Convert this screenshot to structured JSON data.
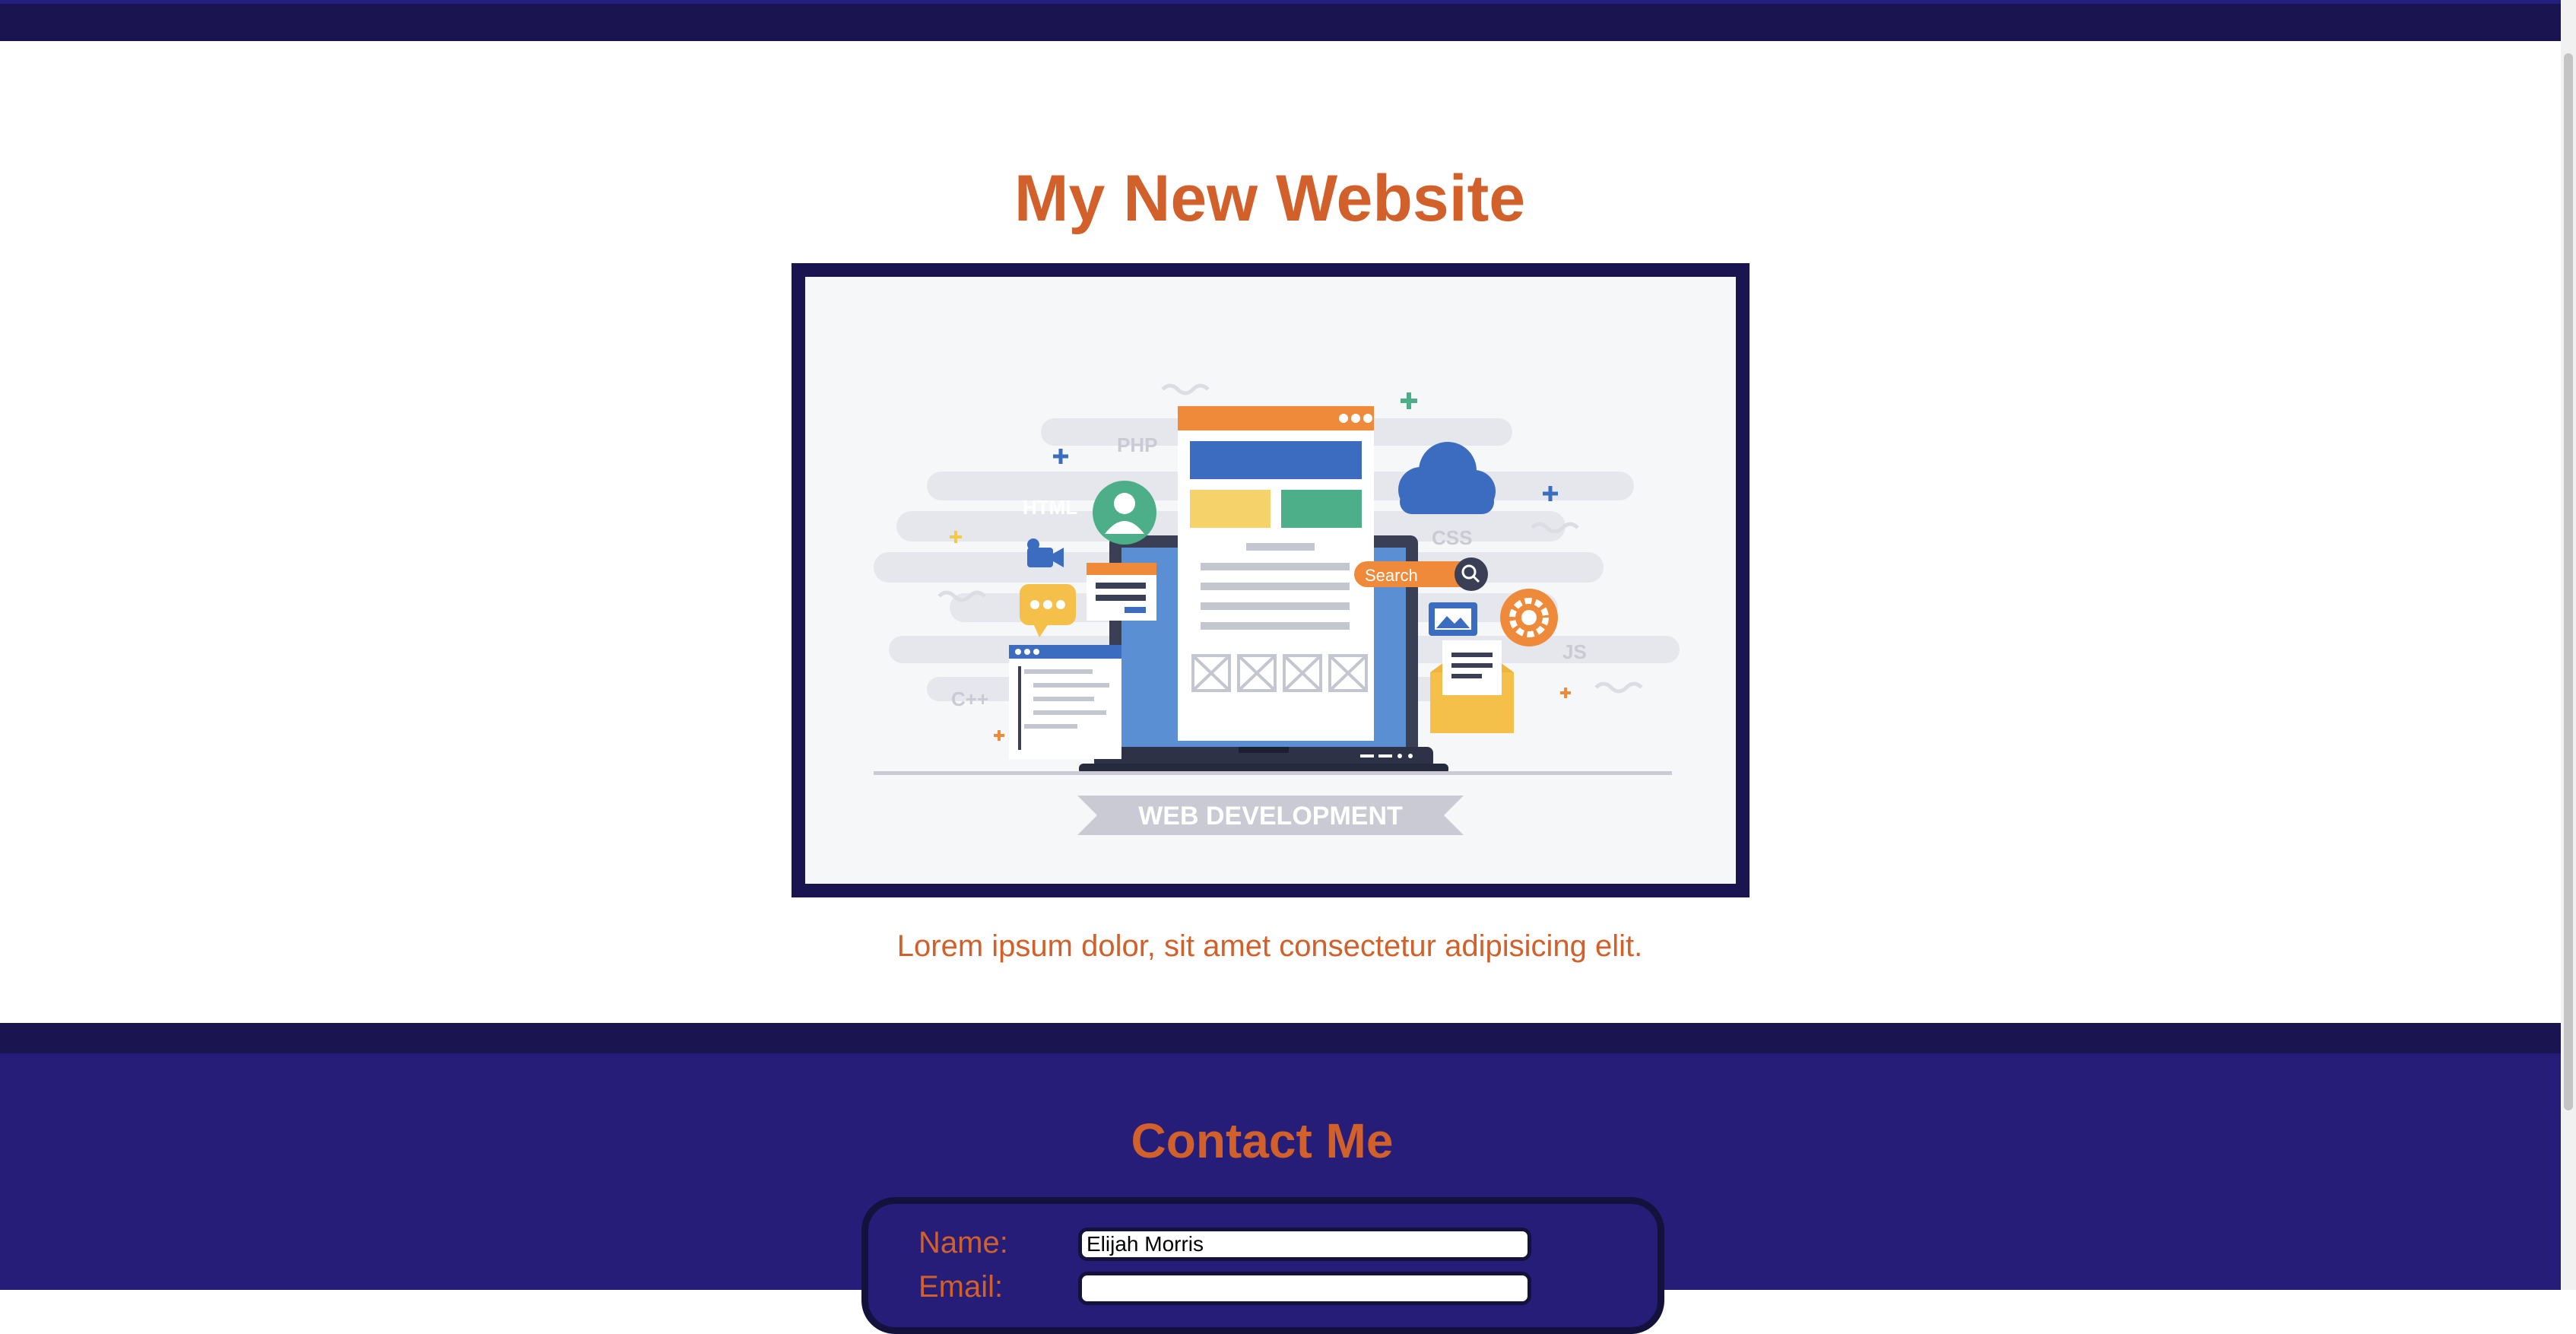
{
  "header": {
    "title": "My New Website"
  },
  "hero": {
    "banner_text": "WEB DEVELOPMENT",
    "labels": [
      "PHP",
      "HTML",
      "CSS",
      "JS",
      "C++"
    ],
    "search_text": "Search"
  },
  "main": {
    "tagline": "Lorem ipsum dolor, sit amet consectetur adipisicing elit."
  },
  "contact": {
    "title": "Contact Me",
    "name_label": "Name:",
    "name_value": "Elijah Morris",
    "email_label": "Email:",
    "email_value": ""
  },
  "colors": {
    "accent": "#d2602a",
    "navy": "#1a1550",
    "footer": "#261d78"
  }
}
